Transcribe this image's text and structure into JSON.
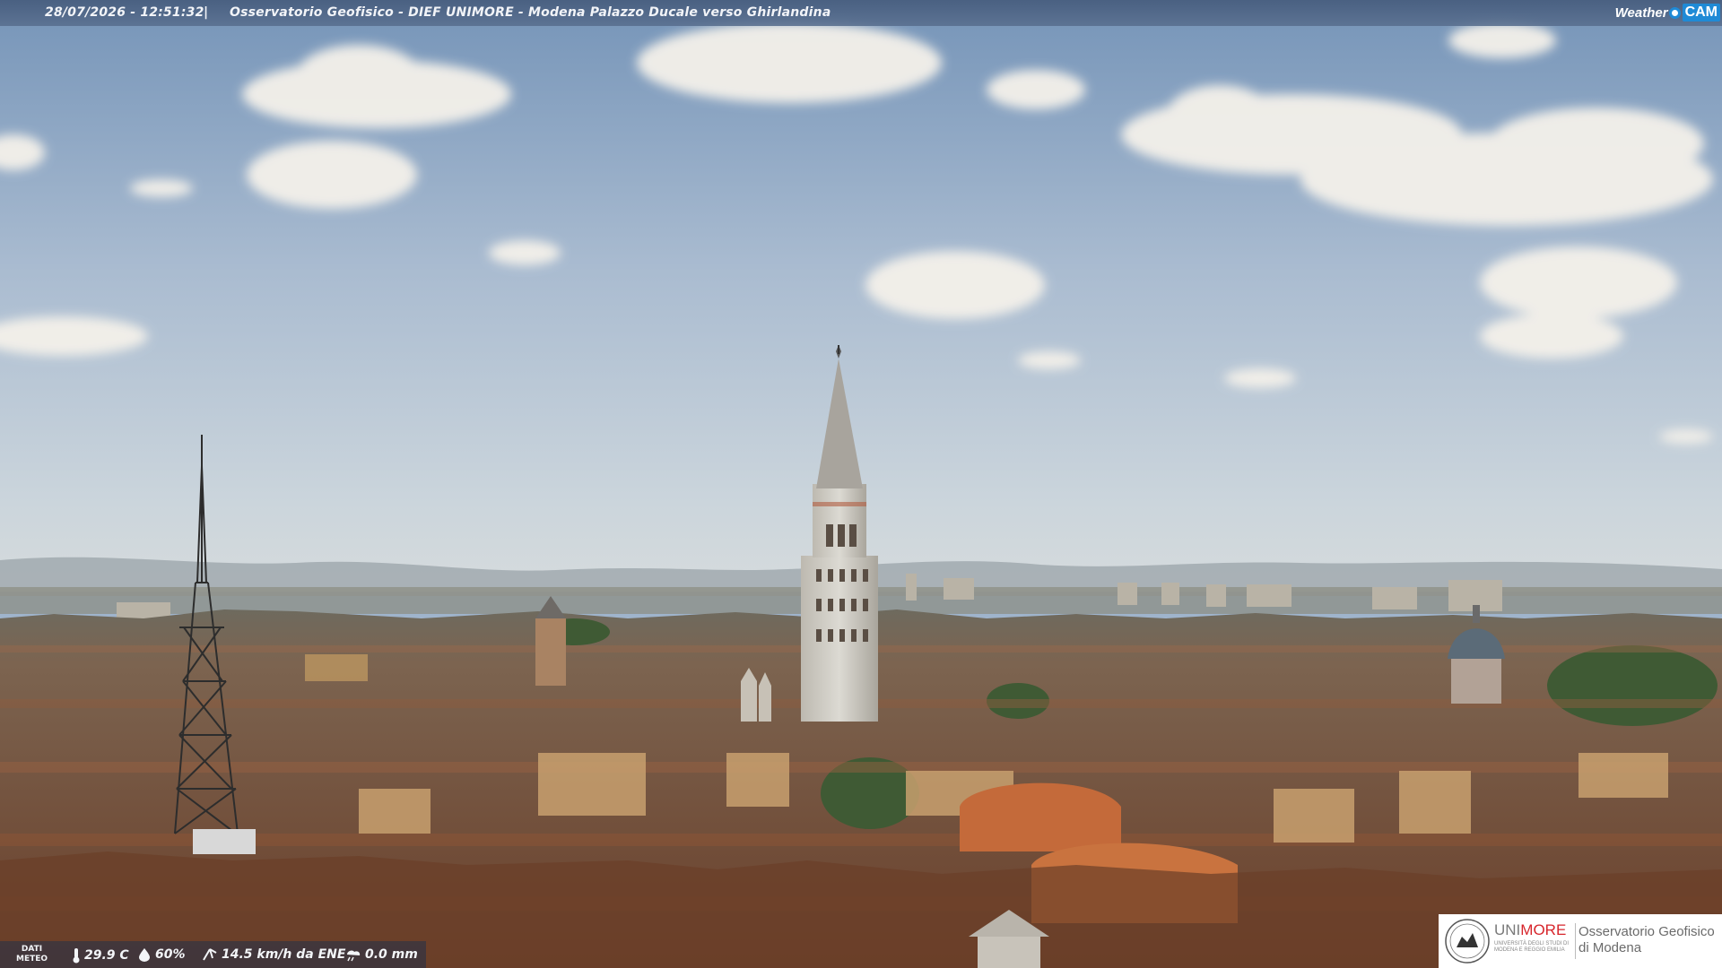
{
  "banner": {
    "timestamp": "28/07/2026 - 12:51:32",
    "separator": "|",
    "title": "Osservatorio Geofisico - DIEF UNIMORE - Modena Palazzo Ducale verso Ghirlandina"
  },
  "brand": {
    "weather_text": "Weather",
    "cam_text": "CAM",
    "accent_color": "#1f8ad6"
  },
  "weather": {
    "label_line1": "DATI",
    "label_line2": "METEO",
    "temperature": "29.9 C",
    "humidity": "60%",
    "wind": "14.5 km/h da ENE",
    "rain": "0.0 mm",
    "icons": [
      "thermometer-icon",
      "humidity-drop-icon",
      "wind-icon",
      "rain-icon"
    ]
  },
  "institution": {
    "uni_prefix": "UNI",
    "uni_suffix": "MORE",
    "uni_subtitle": "UNIVERSITÀ DEGLI STUDI DI MODENA E REGGIO EMILIA",
    "observatory_line1": "Osservatorio Geofisico",
    "observatory_line2": "di Modena",
    "brand_red": "#d7262c"
  },
  "scene": {
    "description_colors": {
      "sky_top": "#7f9bbd",
      "sky_horizon": "#c9d3da",
      "roofs": "#8a5a3e",
      "tower": "#d4d2cc"
    }
  }
}
